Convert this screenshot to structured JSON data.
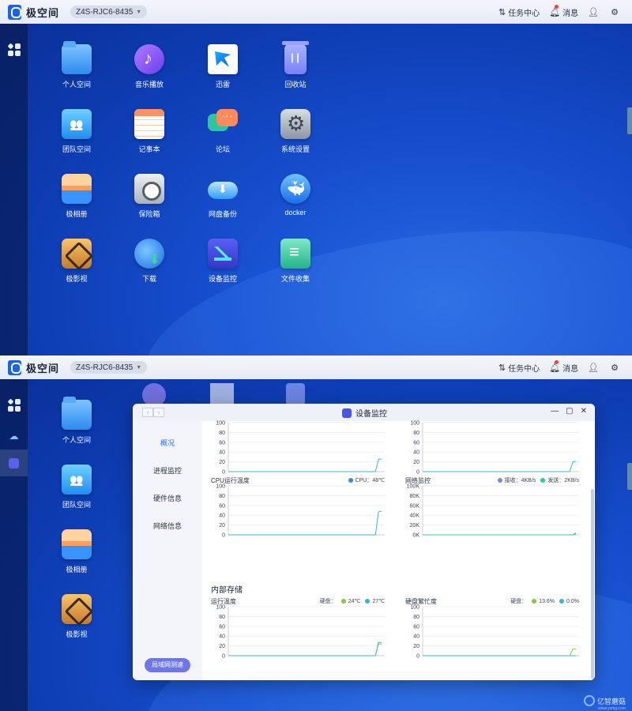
{
  "topbar": {
    "brand": "极空间",
    "device": "Z4S-RJC6-8435",
    "task_center": "任务中心",
    "messages": "消息"
  },
  "desktop_apps": [
    {
      "label": "个人空间",
      "icon": "folder-icon"
    },
    {
      "label": "音乐播放",
      "icon": "music-icon"
    },
    {
      "label": "迅雷",
      "icon": "xunlei-icon"
    },
    {
      "label": "回收站",
      "icon": "trash-icon"
    },
    {
      "label": "团队空间",
      "icon": "team-folder-icon"
    },
    {
      "label": "记事本",
      "icon": "notepad-icon"
    },
    {
      "label": "论坛",
      "icon": "forum-icon"
    },
    {
      "label": "系统设置",
      "icon": "settings-icon"
    },
    {
      "label": "极相册",
      "icon": "album-icon"
    },
    {
      "label": "保险箱",
      "icon": "safe-icon"
    },
    {
      "label": "网盘备份",
      "icon": "cloud-backup-icon"
    },
    {
      "label": "docker",
      "icon": "docker-icon"
    },
    {
      "label": "极影视",
      "icon": "video-icon"
    },
    {
      "label": "下载",
      "icon": "download-icon"
    },
    {
      "label": "设备监控",
      "icon": "monitor-icon"
    },
    {
      "label": "文件收集",
      "icon": "collect-icon"
    }
  ],
  "monitor_window": {
    "title": "设备监控",
    "nav": [
      "概况",
      "进程监控",
      "硬件信息",
      "网络信息"
    ],
    "active_nav": "概况",
    "lan_speed_button": "局域网测速",
    "section_storage": "内部存储"
  },
  "chart_data": [
    {
      "type": "line",
      "title": "",
      "yticks": [
        "100",
        "80",
        "60",
        "40",
        "20",
        "0"
      ],
      "ylim": [
        0,
        100
      ],
      "series": [
        {
          "values": [
            0,
            0,
            0,
            0,
            0,
            0,
            0,
            0,
            0,
            0,
            0,
            0,
            0,
            0,
            0,
            0,
            0,
            0,
            0,
            0,
            0,
            0,
            0,
            0,
            0,
            0,
            0,
            0,
            0,
            0,
            0,
            0,
            0,
            0,
            0,
            0,
            0,
            0,
            0,
            0,
            0,
            0,
            0,
            0,
            0,
            0,
            0,
            0,
            0,
            25,
            26
          ],
          "color": "#3ab6c9"
        }
      ]
    },
    {
      "type": "line",
      "title": "",
      "yticks": [
        "100",
        "80",
        "60",
        "40",
        "20",
        "0"
      ],
      "ylim": [
        0,
        100
      ],
      "series": [
        {
          "values": [
            0,
            0,
            0,
            0,
            0,
            0,
            0,
            0,
            0,
            0,
            0,
            0,
            0,
            0,
            0,
            0,
            0,
            0,
            0,
            0,
            0,
            0,
            0,
            0,
            0,
            0,
            0,
            0,
            0,
            0,
            0,
            0,
            0,
            0,
            0,
            0,
            0,
            0,
            0,
            0,
            0,
            0,
            0,
            0,
            0,
            0,
            0,
            0,
            0,
            20,
            21
          ],
          "color": "#3ab6c9"
        }
      ]
    },
    {
      "type": "line",
      "title": "CPU运行温度",
      "legend": [
        {
          "name": "CPU：48℃",
          "color": "#2f8de4"
        }
      ],
      "yticks": [
        "100",
        "80",
        "60",
        "40",
        "20",
        "0"
      ],
      "ylim": [
        0,
        100
      ],
      "series": [
        {
          "values": [
            0,
            0,
            0,
            0,
            0,
            0,
            0,
            0,
            0,
            0,
            0,
            0,
            0,
            0,
            0,
            0,
            0,
            0,
            0,
            0,
            0,
            0,
            0,
            0,
            0,
            0,
            0,
            0,
            0,
            0,
            0,
            0,
            0,
            0,
            0,
            0,
            0,
            0,
            0,
            0,
            0,
            0,
            0,
            0,
            0,
            0,
            0,
            0,
            0,
            47,
            48
          ],
          "color": "#3ab6c9"
        }
      ]
    },
    {
      "type": "line",
      "title": "网络监控",
      "legend": [
        {
          "name": "接收：4KB/s",
          "color": "#7a86e8"
        },
        {
          "name": "发送：2KB/s",
          "color": "#2ecc8f"
        }
      ],
      "yticks": [
        "100K",
        "80K",
        "60K",
        "40K",
        "20K",
        "0K"
      ],
      "ylim": [
        0,
        100
      ],
      "series": [
        {
          "values": [
            0,
            0,
            0,
            0,
            0,
            0,
            0,
            0,
            0,
            0,
            0,
            0,
            0,
            0,
            0,
            0,
            0,
            0,
            0,
            0,
            0,
            0,
            0,
            0,
            0,
            0,
            0,
            0,
            0,
            0,
            0,
            0,
            0,
            0,
            0,
            0,
            0,
            0,
            0,
            0,
            0,
            0,
            0,
            0,
            0,
            0,
            0,
            0,
            0,
            0,
            4
          ],
          "color": "#7a86e8"
        },
        {
          "values": [
            0,
            0,
            0,
            0,
            0,
            0,
            0,
            0,
            0,
            0,
            0,
            0,
            0,
            0,
            0,
            0,
            0,
            0,
            0,
            0,
            0,
            0,
            0,
            0,
            0,
            0,
            0,
            0,
            0,
            0,
            0,
            0,
            0,
            0,
            0,
            0,
            0,
            0,
            0,
            0,
            0,
            0,
            0,
            0,
            0,
            0,
            0,
            0,
            0,
            0,
            2
          ],
          "color": "#2ecc8f"
        }
      ]
    },
    {
      "type": "line",
      "title": "运行温度",
      "legend_prefix": "硬盘：",
      "legend": [
        {
          "name": "24℃",
          "color": "#8ac43f"
        },
        {
          "name": "27℃",
          "color": "#3ab6c9"
        }
      ],
      "yticks": [
        "100",
        "80",
        "60",
        "40",
        "20",
        "0"
      ],
      "ylim": [
        0,
        100
      ],
      "series": [
        {
          "values": [
            0,
            0,
            0,
            0,
            0,
            0,
            0,
            0,
            0,
            0,
            0,
            0,
            0,
            0,
            0,
            0,
            0,
            0,
            0,
            0,
            0,
            0,
            0,
            0,
            0,
            0,
            0,
            0,
            0,
            0,
            0,
            0,
            0,
            0,
            0,
            0,
            0,
            0,
            0,
            0,
            0,
            0,
            0,
            0,
            0,
            0,
            0,
            0,
            0,
            24,
            24
          ],
          "color": "#8ac43f"
        },
        {
          "values": [
            0,
            0,
            0,
            0,
            0,
            0,
            0,
            0,
            0,
            0,
            0,
            0,
            0,
            0,
            0,
            0,
            0,
            0,
            0,
            0,
            0,
            0,
            0,
            0,
            0,
            0,
            0,
            0,
            0,
            0,
            0,
            0,
            0,
            0,
            0,
            0,
            0,
            0,
            0,
            0,
            0,
            0,
            0,
            0,
            0,
            0,
            0,
            0,
            0,
            27,
            27
          ],
          "color": "#3ab6c9"
        }
      ]
    },
    {
      "type": "line",
      "title": "硬盘繁忙度",
      "legend_prefix": "硬盘：",
      "legend": [
        {
          "name": "13.6%",
          "color": "#8ac43f"
        },
        {
          "name": "0.0%",
          "color": "#3ab6c9"
        }
      ],
      "yticks": [
        "100",
        "80",
        "60",
        "40",
        "20",
        "0"
      ],
      "ylim": [
        0,
        100
      ],
      "series": [
        {
          "values": [
            0,
            0,
            0,
            0,
            0,
            0,
            0,
            0,
            0,
            0,
            0,
            0,
            0,
            0,
            0,
            0,
            0,
            0,
            0,
            0,
            0,
            0,
            0,
            0,
            0,
            0,
            0,
            0,
            0,
            0,
            0,
            0,
            0,
            0,
            0,
            0,
            0,
            0,
            0,
            0,
            0,
            0,
            0,
            0,
            0,
            0,
            0,
            0,
            0,
            13.6,
            13.6
          ],
          "color": "#8ac43f"
        },
        {
          "values": [
            0,
            0,
            0,
            0,
            0,
            0,
            0,
            0,
            0,
            0,
            0,
            0,
            0,
            0,
            0,
            0,
            0,
            0,
            0,
            0,
            0,
            0,
            0,
            0,
            0,
            0,
            0,
            0,
            0,
            0,
            0,
            0,
            0,
            0,
            0,
            0,
            0,
            0,
            0,
            0,
            0,
            0,
            0,
            0,
            0,
            0,
            0,
            0,
            0,
            0,
            0
          ],
          "color": "#3ab6c9"
        }
      ]
    }
  ],
  "watermark": {
    "text": "亿智蘑菇",
    "sub": "www.yzmg.com"
  }
}
